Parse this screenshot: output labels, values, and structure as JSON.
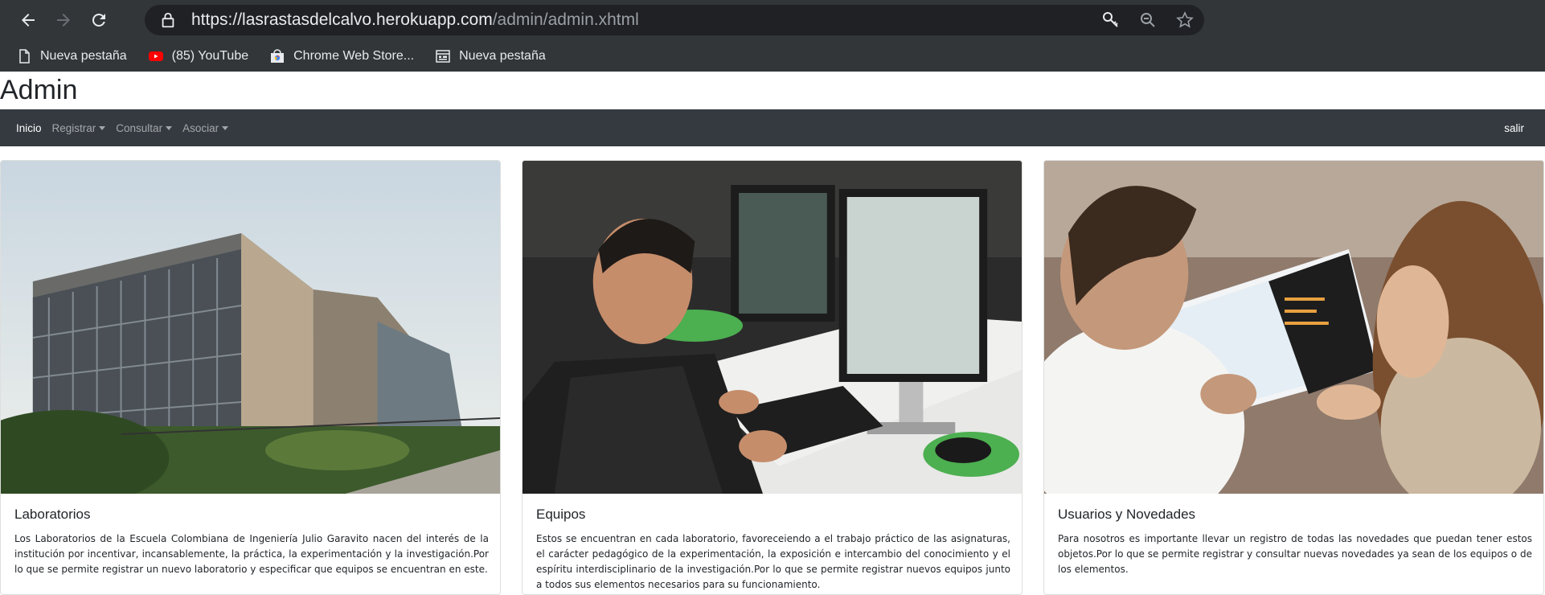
{
  "browser": {
    "url_host": "https://lasrastasdelcalvo.herokuapp.com",
    "url_path": "/admin/admin.xhtml",
    "bookmarks": [
      {
        "label": "Nueva pestaña",
        "icon": "page-icon"
      },
      {
        "label": "(85) YouTube",
        "icon": "youtube-icon"
      },
      {
        "label": "Chrome Web Store...",
        "icon": "chrome-web-store-icon"
      },
      {
        "label": "Nueva pestaña",
        "icon": "grid-page-icon"
      }
    ]
  },
  "page": {
    "title": "Admin",
    "navbar": {
      "home": "Inicio",
      "menus": [
        "Registrar",
        "Consultar",
        "Asociar"
      ],
      "logout": "salir"
    },
    "cards": [
      {
        "title": "Laboratorios",
        "text": "Los Laboratorios de la Escuela Colombiana de Ingeniería Julio Garavito nacen del interés de la institución por incentivar, incansablemente, la práctica, la experimentación y la investigación.Por lo que se permite registrar un nuevo laboratorio y especificar que equipos se encuentran en este.",
        "image": "building-photo"
      },
      {
        "title": "Equipos",
        "text": "Estos se encuentran en cada laboratorio, favoreceiendo a el trabajo práctico de las asignaturas, el carácter pedagógico de la experimentación, la exposición e intercambio del conocimiento y el espíritu interdisciplinario de la investigación.Por lo que se permite registrar nuevos equipos junto a todos sus elementos necesarios para su funcionamiento.",
        "image": "computer-lab-photo"
      },
      {
        "title": "Usuarios y Novedades",
        "text": "Para nosotros es importante llevar un registro de todas las novedades que puedan tener estos objetos.Por lo que se permite registrar y consultar nuevas novedades ya sean de los equipos o de los elementos.",
        "image": "students-photo"
      }
    ]
  },
  "colors": {
    "chrome_bg": "#323639",
    "navbar_bg": "#343a40",
    "omnibox_bg": "#202124"
  }
}
